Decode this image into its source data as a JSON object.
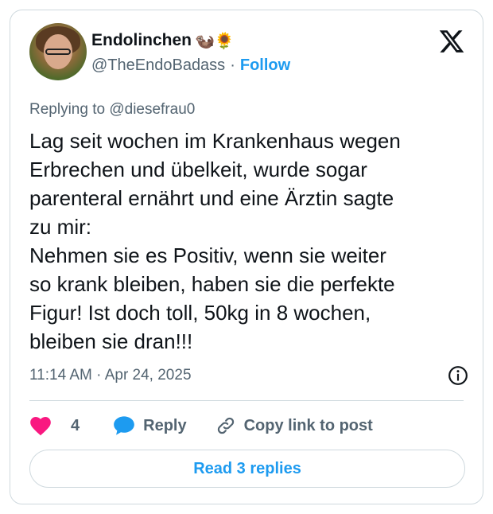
{
  "author": {
    "name": "Endolinchen",
    "name_emojis": "🦦🌻",
    "handle": "@TheEndoBadass",
    "separator": "·",
    "follow_label": "Follow"
  },
  "reply_to": {
    "prefix": "Replying to ",
    "mention": "@diesefrau0"
  },
  "tweet": {
    "lines": [
      "Lag seit wochen im Krankenhaus wegen",
      "Erbrechen und übelkeit, wurde sogar",
      "parenteral ernährt und eine Ärztin sagte",
      "zu mir:",
      "Nehmen sie es Positiv, wenn sie weiter",
      "so krank bleiben, haben sie die perfekte",
      "Figur! Ist doch toll, 50kg in 8 wochen,",
      "bleiben sie dran!!!"
    ],
    "timestamp": "11:14 AM · Apr 24, 2025"
  },
  "actions": {
    "like_count": "4",
    "reply_label": "Reply",
    "copy_link_label": "Copy link to post"
  },
  "read_replies_label": "Read 3 replies",
  "icons": {
    "logo": "x-logo-icon",
    "info": "info-icon",
    "like": "heart-icon",
    "reply": "speech-bubble-icon",
    "copy": "link-icon"
  },
  "colors": {
    "accent": "#1d9bf0",
    "like": "#f91880",
    "text": "#0f1419",
    "secondary": "#536471",
    "border": "#cfd9de"
  }
}
